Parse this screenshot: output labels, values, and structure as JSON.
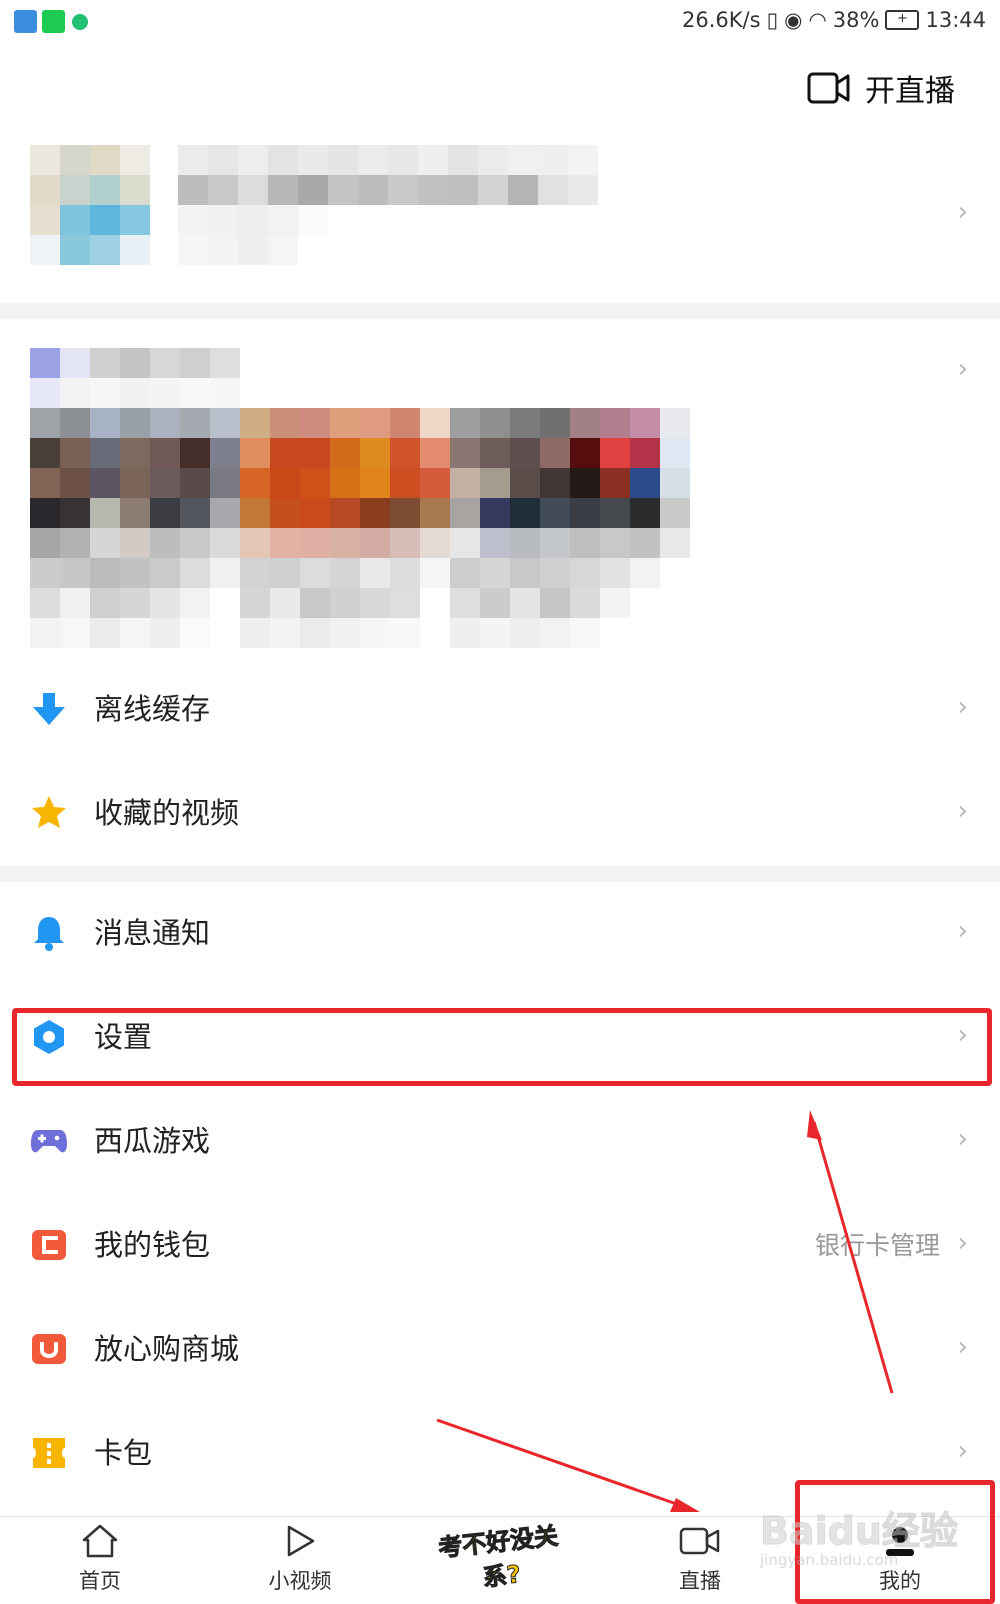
{
  "status_bar": {
    "speed": "26.6K/s",
    "battery": "38%",
    "time": "13:44"
  },
  "header": {
    "live_button_label": "开直播"
  },
  "menu_group_1": [
    {
      "label": "离线缓存",
      "icon": "download-arrow-icon"
    },
    {
      "label": "收藏的视频",
      "icon": "star-icon"
    }
  ],
  "menu_group_2": [
    {
      "label": "消息通知",
      "icon": "bell-icon"
    },
    {
      "label": "设置",
      "icon": "hexagon-settings-icon"
    },
    {
      "label": "西瓜游戏",
      "icon": "gamepad-icon"
    },
    {
      "label": "我的钱包",
      "icon": "wallet-icon",
      "sub": "银行卡管理"
    },
    {
      "label": "放心购商城",
      "icon": "shopping-bag-icon"
    },
    {
      "label": "卡包",
      "icon": "ticket-icon"
    }
  ],
  "bottom_nav": {
    "home": "首页",
    "short_video": "小视频",
    "promo_badge": "考不好没关系?",
    "live": "直播",
    "mine": "我的"
  },
  "watermark": {
    "brand": "Baidu经验",
    "url": "jingyan.baidu.com"
  },
  "colors": {
    "accent_blue": "#2196f3",
    "star_yellow": "#f7b500",
    "game_purple": "#6f6fdc",
    "wallet_orange": "#f05a3a",
    "annotation_red": "#e8262b"
  }
}
